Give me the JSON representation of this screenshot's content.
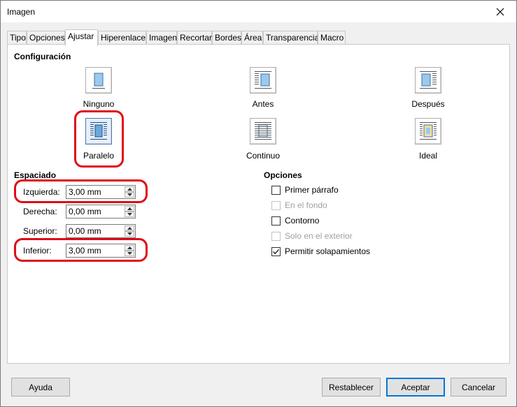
{
  "window": {
    "title": "Imagen",
    "close_icon": "close-icon"
  },
  "tabs": [
    {
      "label": "Tipo"
    },
    {
      "label": "Opciones"
    },
    {
      "label": "Ajustar"
    },
    {
      "label": "Hiperenlace"
    },
    {
      "label": "Imagen"
    },
    {
      "label": "Recortar"
    },
    {
      "label": "Bordes"
    },
    {
      "label": "Área"
    },
    {
      "label": "Transparencia"
    },
    {
      "label": "Macro"
    }
  ],
  "active_tab": "Ajustar",
  "configuracion": {
    "title": "Configuración",
    "options": [
      {
        "label": "Ninguno",
        "icon": "wrap-none-icon"
      },
      {
        "label": "Antes",
        "icon": "wrap-before-icon"
      },
      {
        "label": "Después",
        "icon": "wrap-after-icon"
      },
      {
        "label": "Paralelo",
        "icon": "wrap-parallel-icon",
        "selected": true
      },
      {
        "label": "Continuo",
        "icon": "wrap-through-icon"
      },
      {
        "label": "Ideal",
        "icon": "wrap-ideal-icon"
      }
    ]
  },
  "espaciado": {
    "title": "Espaciado",
    "fields": [
      {
        "label": "Izquierda:",
        "value": "3,00 mm"
      },
      {
        "label": "Derecha:",
        "value": "0,00 mm"
      },
      {
        "label": "Superior:",
        "value": "0,00 mm"
      },
      {
        "label": "Inferior:",
        "value": "3,00 mm"
      }
    ]
  },
  "opciones": {
    "title": "Opciones",
    "checkboxes": [
      {
        "label": "Primer párrafo",
        "checked": false,
        "enabled": true
      },
      {
        "label": "En el fondo",
        "checked": false,
        "enabled": false
      },
      {
        "label": "Contorno",
        "checked": false,
        "enabled": true
      },
      {
        "label": "Solo en el exterior",
        "checked": false,
        "enabled": false
      },
      {
        "label": "Permitir solapamientos",
        "checked": true,
        "enabled": true
      }
    ]
  },
  "buttons": {
    "help": "Ayuda",
    "reset": "Restablecer",
    "ok": "Aceptar",
    "cancel": "Cancelar"
  },
  "colors": {
    "annotation_red": "#e00c16",
    "accent_blue": "#0078d7"
  }
}
